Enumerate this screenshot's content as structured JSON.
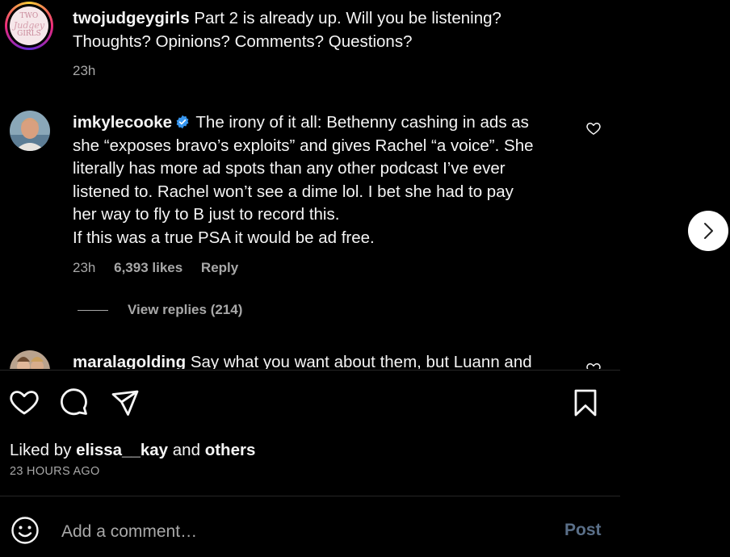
{
  "comments": [
    {
      "username": "twojudgeygirls",
      "text": "Part 2 is already up. Will you be listening? Thoughts? Opinions? Comments? Questions?",
      "time": "23h",
      "avatar_text": {
        "line1": "TWO",
        "line2": "Judgey",
        "line3": "GIRLS"
      }
    },
    {
      "username": "imkylecooke",
      "verified": true,
      "text_lines": [
        "The irony of it all: Bethenny cashing in ads as",
        "she “exposes bravo’s exploits” and gives Rachel “a voice”. She",
        "literally has more ad spots than any other podcast I’ve ever",
        "listened to. Rachel won’t see a dime lol. I bet she had to pay",
        "her way to fly to B just to record this.",
        "If this was a true PSA it would be ad free."
      ],
      "time": "23h",
      "likes": "6,393 likes",
      "reply_label": "Reply",
      "view_replies": "View replies (214)"
    },
    {
      "username": "maralagolding",
      "text": "Say what you want about them, but Luann and"
    }
  ],
  "actions": {
    "like_icon": "heart-icon",
    "comment_icon": "comment-icon",
    "share_icon": "share-icon",
    "save_icon": "bookmark-icon"
  },
  "liked_by": {
    "prefix": "Liked by",
    "user": "elissa__kay",
    "middle": "and",
    "others": "others"
  },
  "posted_ago": "23 HOURS AGO",
  "add_comment": {
    "placeholder": "Add a comment…",
    "post_label": "Post"
  },
  "colors": {
    "background": "#000000",
    "muted": "#a8a8a8",
    "post_disabled": "#5a6f88",
    "verified": "#3897f0"
  }
}
